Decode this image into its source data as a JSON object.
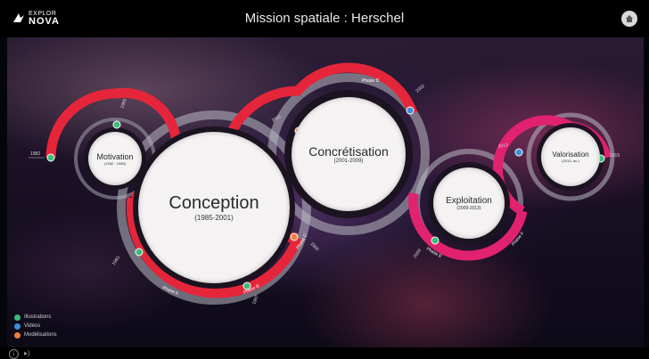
{
  "header": {
    "logo_top": "EXPLOR",
    "logo_bottom": "NOVA",
    "title": "Mission spatiale : Herschel",
    "home_icon": "home-icon"
  },
  "phases_ring": {
    "phase_a": "Phase A",
    "phase_b": "Phase B",
    "phase_c": "Phase C",
    "phase_d": "Phase D",
    "phase_e": "Phase E",
    "phase_f": "Phase F"
  },
  "stages": {
    "motivation": {
      "name": "Motivation",
      "dates": "(1982 - 1985)"
    },
    "conception": {
      "name": "Conception",
      "dates": "(1985-2001)"
    },
    "concretisation": {
      "name": "Concrétisation",
      "dates": "(2001-2009)"
    },
    "exploitation": {
      "name": "Exploitation",
      "dates": "(2009-2013)"
    },
    "valorisation": {
      "name": "Valorisation",
      "dates": "(2013- au.)"
    }
  },
  "years": {
    "y1982": "1982",
    "y1985": "1985",
    "y1993": "1993",
    "y1997": "1997",
    "y2001": "2001",
    "y2002": "2002",
    "y2009": "2009",
    "y2013a": "2013",
    "y2013b": "2013",
    "y2015": "2015",
    "y2005": "2005"
  },
  "legend": {
    "items": [
      {
        "label": "Illustrations",
        "color": "#3dbb7a"
      },
      {
        "label": "Vidéos",
        "color": "#3b8fd9"
      },
      {
        "label": "Modélisations",
        "color": "#f07f3a"
      }
    ]
  },
  "colors": {
    "red_track": "#e5263a",
    "pink_track": "#e0226f",
    "green_marker": "#3dbb7a",
    "blue_marker": "#3b8fd9",
    "orange_marker": "#f07f3a"
  },
  "footer": {
    "info_icon": "info-icon",
    "sound_icon": "sound-icon"
  }
}
